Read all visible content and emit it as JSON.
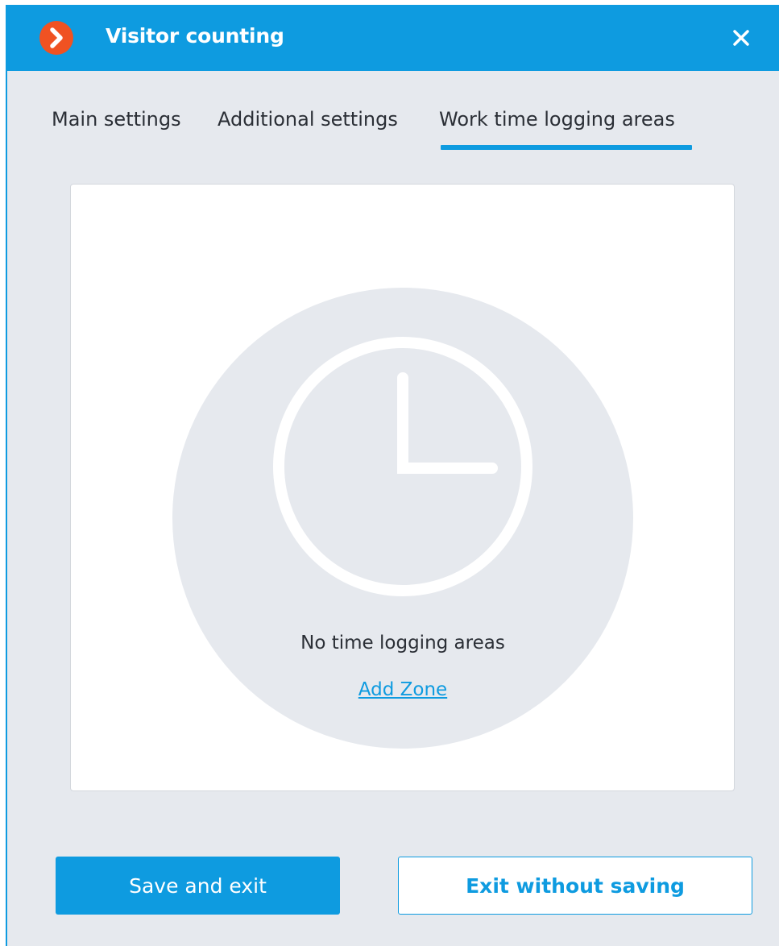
{
  "window": {
    "title": "Visitor counting",
    "accent_color": "#0e9be0",
    "logo_color": "#f05222",
    "logo_icon": "chevron-right-icon",
    "close_icon": "close-icon"
  },
  "tabs": [
    {
      "label": "Main settings",
      "active": false
    },
    {
      "label": "Additional settings",
      "active": false
    },
    {
      "label": "Work time logging areas",
      "active": true
    }
  ],
  "panel": {
    "icon": "clock-icon",
    "empty_message": "No time logging areas",
    "add_link": "Add Zone"
  },
  "buttons": {
    "save": "Save and exit",
    "exit": "Exit without saving"
  }
}
